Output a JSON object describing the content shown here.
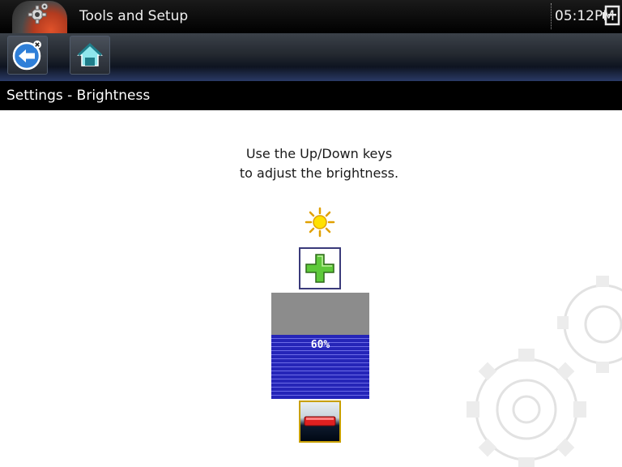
{
  "header": {
    "title": "Tools and Setup",
    "time": "05:12PM",
    "app_icon": "gear-icon",
    "battery_icon": "battery-icon"
  },
  "toolbar": {
    "back_icon": "back-arrow-icon",
    "home_icon": "home-icon"
  },
  "breadcrumb": {
    "text": "Settings - Brightness"
  },
  "main": {
    "instruction_line1": "Use the Up/Down keys",
    "instruction_line2": "to adjust the brightness.",
    "brightness": {
      "percent": 60,
      "label": "60%"
    },
    "increase_icon": "plus-icon",
    "decrease_icon": "minus-icon",
    "brightness_icon": "sun-icon"
  },
  "colors": {
    "gauge_fill": "#2525b8",
    "gauge_empty": "#8c8c8c",
    "plus": "#5ec93a",
    "minus": "#e02020"
  }
}
